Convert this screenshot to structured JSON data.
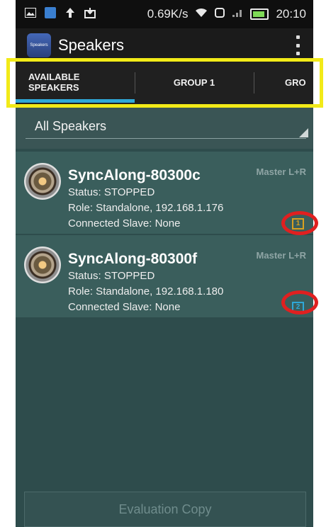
{
  "status_bar": {
    "net_speed": "0.69K/s",
    "time": "20:10"
  },
  "app": {
    "icon_text": "Speakers",
    "title": "Speakers"
  },
  "tabs": [
    {
      "label_line1": "AVAILABLE",
      "label_line2": "SPEAKERS",
      "selected": true
    },
    {
      "label": "GROUP 1"
    },
    {
      "label": "GRO"
    }
  ],
  "filter": {
    "label": "All Speakers"
  },
  "speakers": [
    {
      "name": "SyncAlong-80300c",
      "status": "Status: STOPPED",
      "role": "Role: Standalone,  192.168.1.176",
      "slave": "Connected Slave: None",
      "master": "Master  L+R",
      "badge": "1",
      "badge_color": "#d8a020"
    },
    {
      "name": "SyncAlong-80300f",
      "status": "Status: STOPPED",
      "role": "Role: Standalone,  192.168.1.180",
      "slave": "Connected Slave: None",
      "master": "Master  L+R",
      "badge": "2",
      "badge_color": "#2fa8d8"
    }
  ],
  "footer": {
    "button": "Evaluation Copy"
  },
  "colors": {
    "accent": "#2fa8d8",
    "highlight": "#f2ea18",
    "annotation": "#e02020"
  }
}
